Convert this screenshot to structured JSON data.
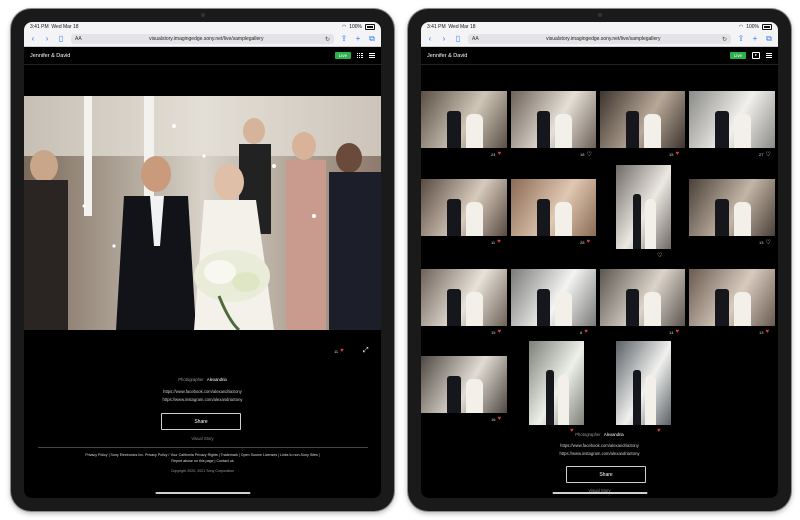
{
  "status": {
    "time": "3:41 PM",
    "date": "Wed Mar 18",
    "battery": "100%"
  },
  "browser": {
    "text_size": "AA",
    "url": "visualstory.imagingedge.sony.net/live/samplegallery"
  },
  "app": {
    "title": "Jennifer & David",
    "live_label": "Live"
  },
  "left": {
    "featured": {
      "likes": "11"
    },
    "photographer_label": "Photographer",
    "photographer_name": "Alexandria",
    "facebook": "https://www.facebook.com/alexandriaSony",
    "instagram": "https://www.instagram.com/alexandriaSony",
    "share_label": "Share",
    "brand": "Visual Story",
    "footer": {
      "line1": "Privacy Policy  |  Sony Electronics Inc. Privacy Policy / Your California Privacy Rights  |  Trademark  |  Open Source Licenses  |  Links to non-Sony Sites  |",
      "line2": "Report abuse on this page  |  Contact us",
      "copyright": "Copyright 2020, 2021 Sony Corporation"
    }
  },
  "right": {
    "photos": [
      {
        "likes": "24",
        "liked": true
      },
      {
        "likes": "18",
        "liked": false
      },
      {
        "likes": "15",
        "liked": true
      },
      {
        "likes": "27",
        "liked": false
      },
      {
        "likes": "11",
        "liked": true
      },
      {
        "likes": "28",
        "liked": true
      },
      {
        "likes": "",
        "liked": false
      },
      {
        "likes": "13",
        "liked": false
      },
      {
        "likes": "15",
        "liked": true
      },
      {
        "likes": "8",
        "liked": true
      },
      {
        "likes": "14",
        "liked": true
      },
      {
        "likes": "13",
        "liked": true
      },
      {
        "likes": "16",
        "liked": true
      },
      {
        "likes": "",
        "liked": true
      },
      {
        "likes": "",
        "liked": true
      }
    ],
    "photographer_label": "Photographer",
    "photographer_name": "Alexandria",
    "facebook": "https://www.facebook.com/alexandriaSony",
    "instagram": "https://www.instagram.com/alexandriaSony",
    "share_label": "Share",
    "brand": "Visual Story"
  },
  "colors": {
    "live": "#2bb24c",
    "heart": "#e23a45",
    "accent": "#2f7cf6"
  }
}
